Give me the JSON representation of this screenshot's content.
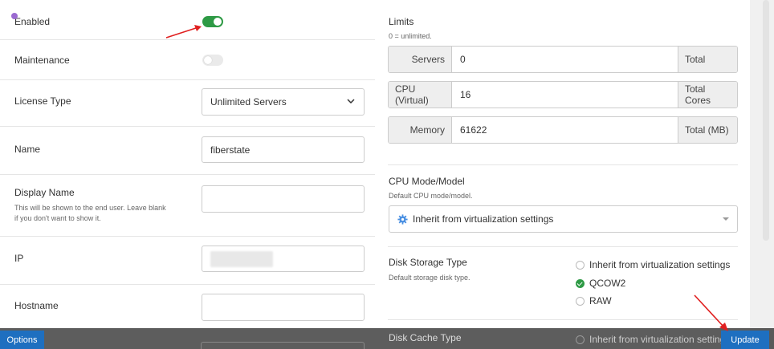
{
  "left": {
    "enabled": {
      "label": "Enabled",
      "state": "on"
    },
    "maintenance": {
      "label": "Maintenance",
      "state": "off"
    },
    "license_type": {
      "label": "License Type",
      "value": "Unlimited Servers"
    },
    "name": {
      "label": "Name",
      "value": "fiberstate"
    },
    "display_name": {
      "label": "Display Name",
      "hint_line1": "This will be shown to the end user. Leave blank",
      "hint_line2": "if you don't want to show it.",
      "value": ""
    },
    "ip": {
      "label": "IP",
      "value": ""
    },
    "hostname": {
      "label": "Hostname",
      "value": ""
    }
  },
  "limits": {
    "title": "Limits",
    "subtitle": "0 = unlimited.",
    "rows": [
      {
        "label": "Servers",
        "value": "0",
        "unit": "Total"
      },
      {
        "label": "CPU (Virtual)",
        "value": "16",
        "unit": "Total Cores"
      },
      {
        "label": "Memory",
        "value": "61622",
        "unit": "Total (MB)"
      }
    ]
  },
  "cpu_mode": {
    "title": "CPU Mode/Model",
    "subtitle": "Default CPU mode/model.",
    "selected": "Inherit from virtualization settings",
    "icon": "gear-icon"
  },
  "disk_storage": {
    "title": "Disk Storage Type",
    "subtitle": "Default storage disk type.",
    "options": [
      {
        "label": "Inherit from virtualization settings",
        "checked": false
      },
      {
        "label": "QCOW2",
        "checked": true
      },
      {
        "label": "RAW",
        "checked": false
      }
    ]
  },
  "disk_cache": {
    "title": "Disk Cache Type",
    "first_option": "Inherit from virtualization settings"
  },
  "footer": {
    "options_label": "Options",
    "update_label": "Update"
  },
  "colors": {
    "accent_green": "#2e9a45",
    "button_blue": "#1e6fc0",
    "arrow_red": "#e02020"
  }
}
